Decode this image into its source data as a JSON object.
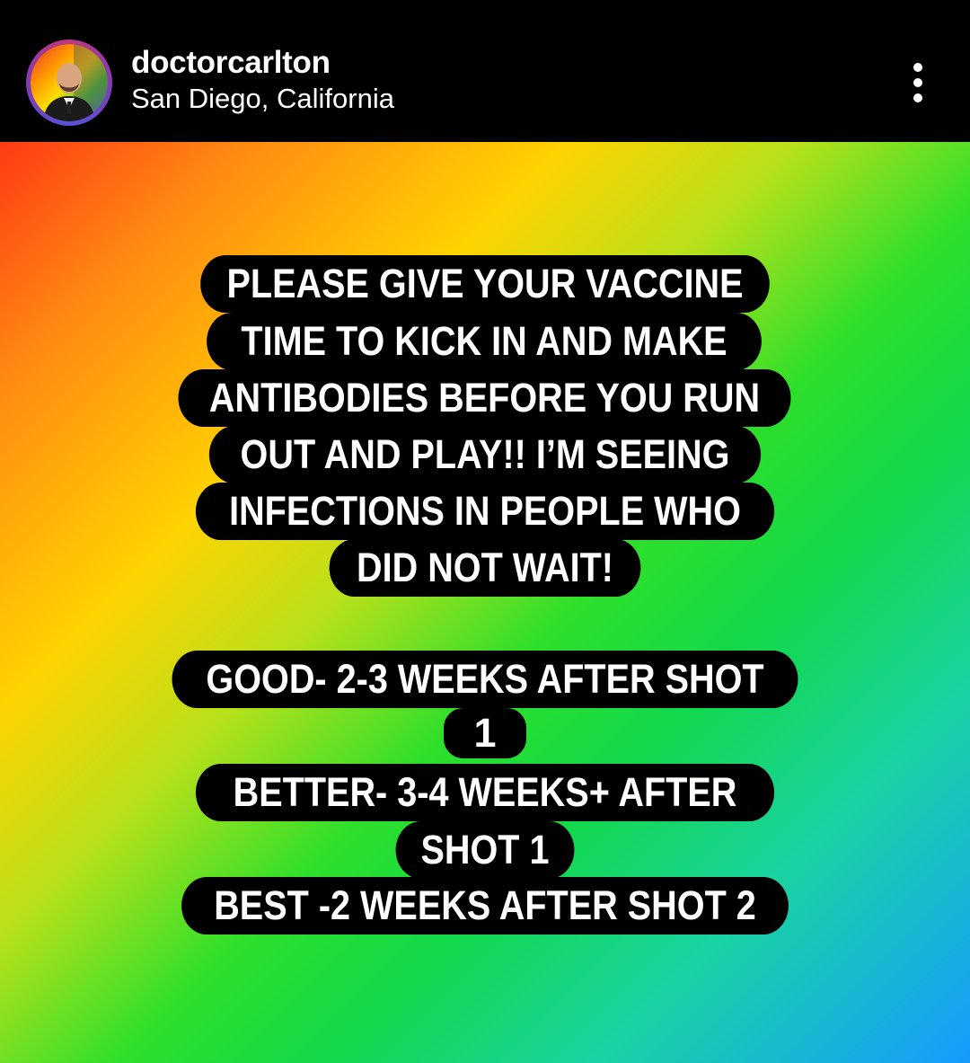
{
  "header": {
    "username": "doctorcarlton",
    "location": "San Diego, California",
    "avatar_icon": "profile-photo",
    "more_icon": "more-options-icon"
  },
  "story": {
    "paragraph1": [
      "PLEASE GIVE YOUR VACCINE",
      "TIME TO KICK IN AND MAKE",
      "ANTIBODIES BEFORE YOU RUN",
      "OUT AND PLAY!! I’M SEEING",
      "INFECTIONS IN PEOPLE WHO",
      "DID NOT WAIT!"
    ],
    "paragraph2": [
      "GOOD- 2-3 WEEKS AFTER SHOT",
      "1",
      "BETTER- 3-4 WEEKS+ AFTER",
      "SHOT 1",
      "BEST -2 WEEKS AFTER SHOT 2"
    ],
    "background_colors": [
      "#ff3a14",
      "#ff8a12",
      "#ffd300",
      "#2ddf2a",
      "#169bff"
    ]
  }
}
